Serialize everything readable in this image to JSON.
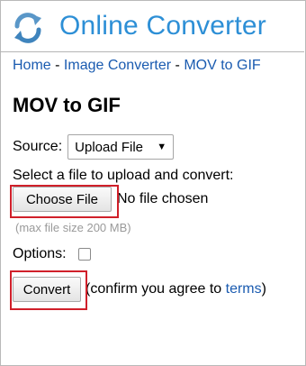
{
  "header": {
    "site_title": "Online Converter",
    "logo_icon": "refresh-arrows-icon",
    "brand_color": "#2d8fd6"
  },
  "breadcrumb": {
    "items": [
      "Home",
      "Image Converter",
      "MOV to GIF"
    ],
    "separator": "-"
  },
  "page_title": "MOV to GIF",
  "source": {
    "label": "Source:",
    "selected": "Upload File"
  },
  "upload": {
    "prompt": "Select a file to upload and convert:",
    "button_label": "Choose File",
    "status": "No file chosen",
    "hint": "(max file size 200 MB)"
  },
  "options": {
    "label": "Options:",
    "checked": false
  },
  "convert": {
    "button_label": "Convert",
    "confirm_prefix": "(confirm you agree to ",
    "terms_link": "terms",
    "confirm_suffix": ")"
  },
  "colors": {
    "link": "#1a5bb0",
    "highlight": "#d0202a"
  }
}
